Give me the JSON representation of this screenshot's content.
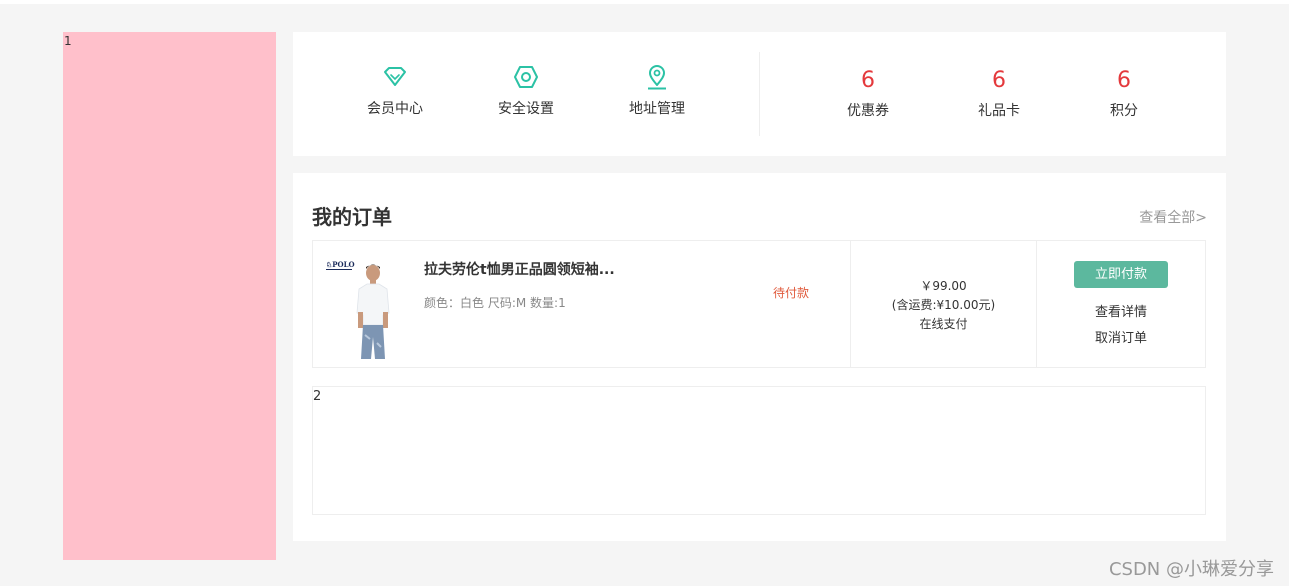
{
  "left_panel": {
    "marker": "1"
  },
  "quick_links": [
    {
      "label": "会员中心",
      "icon": "diamond-icon"
    },
    {
      "label": "安全设置",
      "icon": "hexagon-settings-icon"
    },
    {
      "label": "地址管理",
      "icon": "location-pin-icon"
    }
  ],
  "stats": [
    {
      "value": "6",
      "label": "优惠券"
    },
    {
      "value": "6",
      "label": "礼品卡"
    },
    {
      "value": "6",
      "label": "积分"
    }
  ],
  "orders": {
    "title": "我的订单",
    "view_all": "查看全部>",
    "items": [
      {
        "product_name": "拉夫劳伦t恤男正品圆领短袖...",
        "spec": "颜色：白色 尺码:M 数量:1",
        "status": "待付款",
        "price": "￥99.00",
        "shipping": "(含运费:¥10.00元)",
        "payment": "在线支付",
        "pay_button": "立即付款",
        "detail_link": "查看详情",
        "cancel_link": "取消订单"
      }
    ],
    "second_marker": "2"
  },
  "watermark": "CSDN @小琳爱分享",
  "colors": {
    "accent": "#5cb89e",
    "icon": "#2bc2a5",
    "stat_number": "#e4393c",
    "status": "#e05a3c",
    "left_panel": "#ffc0cb"
  }
}
